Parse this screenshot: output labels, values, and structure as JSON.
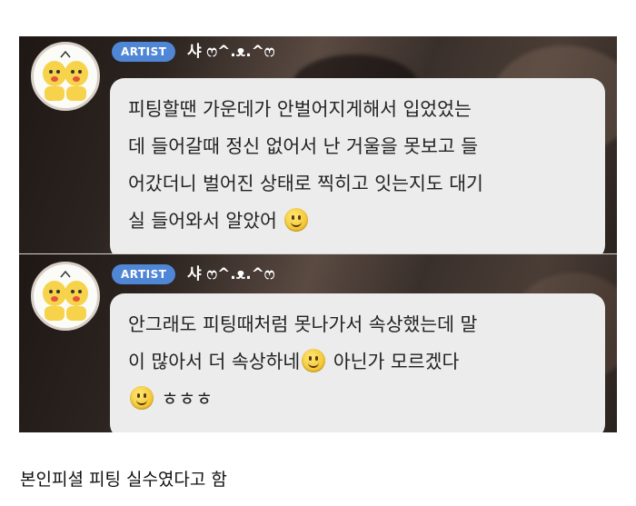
{
  "messages": [
    {
      "badge": "ARTIST",
      "nickname": "샤 ෆ^.ᴥ.^ෆ",
      "lines": [
        "피팅할땐 가운데가 안벌어지게해서 입었었는",
        "데 들어갈때 정신 없어서 난 거울을 못보고 들",
        "어갔더니 벌어진 상태로 찍히고 잇는지도 대기",
        "실 들어와서 알았어"
      ],
      "emoji": "slightly-smiling-face"
    },
    {
      "badge": "ARTIST",
      "nickname": "샤 ෆ^.ᴥ.^ෆ",
      "lines": [
        "안그래도 피팅때처럼 못나가서 속상했는데 말",
        "이 많아서 더 속상하네",
        " 아닌가 모르겠다",
        "ㅎㅎㅎ"
      ],
      "emoji": "slightly-smiling-face"
    }
  ],
  "caption": "본인피셜 피팅 실수였다고 함"
}
